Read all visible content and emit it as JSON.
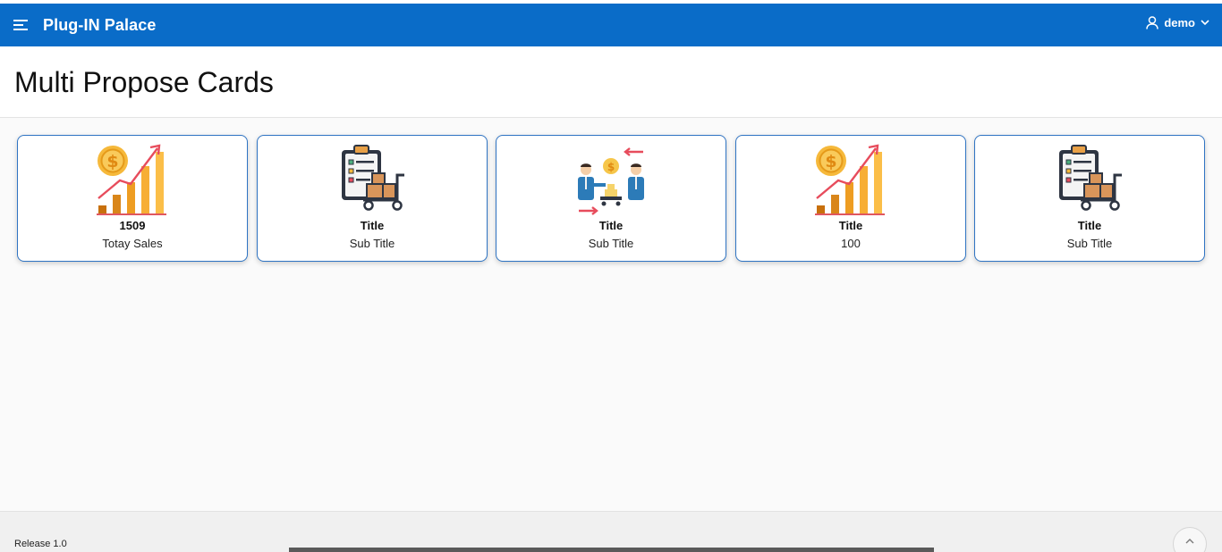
{
  "app": {
    "title": "Plug-IN Palace",
    "user": "demo"
  },
  "page": {
    "title": "Multi Propose Cards"
  },
  "cards": [
    {
      "icon": "sales-growth-chart-icon",
      "title": "1509",
      "subtitle": "Totay Sales"
    },
    {
      "icon": "clipboard-cart-icon",
      "title": "Title",
      "subtitle": "Sub Title"
    },
    {
      "icon": "business-exchange-icon",
      "title": "Title",
      "subtitle": "Sub Title"
    },
    {
      "icon": "sales-growth-chart-icon",
      "title": "Title",
      "subtitle": "100"
    },
    {
      "icon": "clipboard-cart-icon",
      "title": "Title",
      "subtitle": "Sub Title"
    }
  ],
  "footer": {
    "release": "Release 1.0"
  },
  "colors": {
    "header_bg": "#0a6cc8",
    "card_border": "#2f74c3",
    "page_bg": "#fafafa"
  }
}
